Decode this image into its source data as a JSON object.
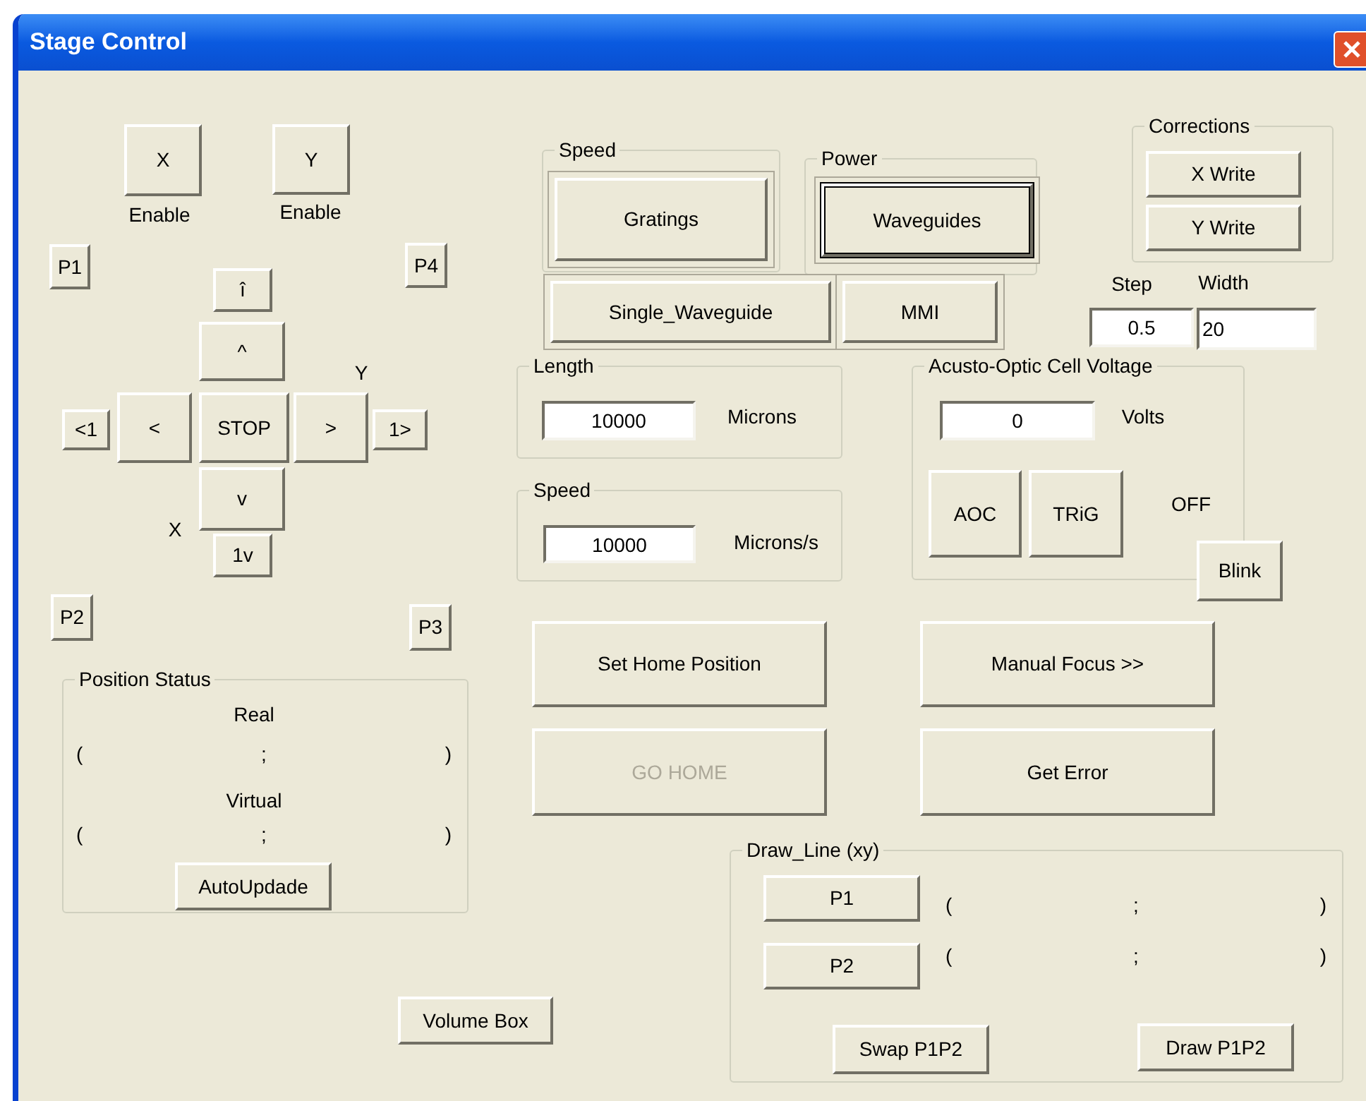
{
  "window": {
    "title": "Stage Control"
  },
  "controls": [
    {
      "kind": "button",
      "label": "X",
      "disabled": false
    },
    {
      "kind": "label",
      "text": "Enable"
    },
    {
      "kind": "button",
      "label": "Y",
      "disabled": false
    },
    {
      "kind": "label",
      "text": "Enable"
    },
    {
      "kind": "button",
      "label": "P1",
      "disabled": false
    },
    {
      "kind": "button",
      "label": "P4",
      "disabled": false
    },
    {
      "kind": "button",
      "label": "î",
      "disabled": false
    },
    {
      "kind": "button",
      "label": "^",
      "disabled": false
    },
    {
      "kind": "label",
      "text": "Y"
    },
    {
      "kind": "button",
      "label": "<1",
      "disabled": false
    },
    {
      "kind": "button",
      "label": "<",
      "disabled": false
    },
    {
      "kind": "button",
      "label": "STOP",
      "disabled": false
    },
    {
      "kind": "button",
      "label": ">",
      "disabled": false
    },
    {
      "kind": "button",
      "label": "1>",
      "disabled": false
    },
    {
      "kind": "button",
      "label": "v",
      "disabled": false
    },
    {
      "kind": "label",
      "text": "X"
    },
    {
      "kind": "button",
      "label": "1v",
      "disabled": false
    },
    {
      "kind": "button",
      "label": "P2",
      "disabled": false
    },
    {
      "kind": "button",
      "label": "P3",
      "disabled": false
    },
    {
      "kind": "group",
      "label": "Position Status"
    },
    {
      "kind": "label",
      "text": "Real"
    },
    {
      "kind": "coords",
      "open": "(",
      "sep": ";",
      "close": ")"
    },
    {
      "kind": "label",
      "text": "Virtual"
    },
    {
      "kind": "coords",
      "open": "(",
      "sep": ";",
      "close": ")"
    },
    {
      "kind": "button",
      "label": "AutoUpdade",
      "disabled": false
    },
    {
      "kind": "button",
      "label": "Volume Box",
      "disabled": false
    },
    {
      "kind": "group",
      "label": "Speed"
    },
    {
      "kind": "framed",
      "label": "Gratings",
      "disabled": false,
      "focused": false
    },
    {
      "kind": "group",
      "label": "Power"
    },
    {
      "kind": "framed",
      "label": "Waveguides",
      "disabled": false,
      "focused": true
    },
    {
      "kind": "framed",
      "label": "Single_Waveguide",
      "disabled": false,
      "focused": false
    },
    {
      "kind": "framed",
      "label": "MMI",
      "disabled": false,
      "focused": false
    },
    {
      "kind": "group",
      "label": "Corrections"
    },
    {
      "kind": "button",
      "label": "X Write",
      "disabled": false
    },
    {
      "kind": "button",
      "label": "Y Write",
      "disabled": false
    },
    {
      "kind": "label",
      "text": "Step"
    },
    {
      "kind": "label",
      "text": "Width"
    },
    {
      "kind": "field",
      "value": "0.5"
    },
    {
      "kind": "field",
      "value": "20"
    },
    {
      "kind": "group",
      "label": "Length"
    },
    {
      "kind": "field",
      "value": "10000"
    },
    {
      "kind": "label",
      "text": "Microns"
    },
    {
      "kind": "group",
      "label": "Speed"
    },
    {
      "kind": "field",
      "value": "10000"
    },
    {
      "kind": "label",
      "text": "Microns/s"
    },
    {
      "kind": "group",
      "label": "Acusto-Optic Cell Voltage"
    },
    {
      "kind": "field",
      "value": "0"
    },
    {
      "kind": "label",
      "text": "Volts"
    },
    {
      "kind": "button",
      "label": "AOC",
      "disabled": false
    },
    {
      "kind": "button",
      "label": "TRiG",
      "disabled": false
    },
    {
      "kind": "label",
      "text": "OFF"
    },
    {
      "kind": "button",
      "label": "Blink",
      "disabled": false
    },
    {
      "kind": "button",
      "label": "Set Home Position",
      "disabled": false
    },
    {
      "kind": "button",
      "label": "GO HOME",
      "disabled": true
    },
    {
      "kind": "button",
      "label": "Manual Focus >>",
      "disabled": false
    },
    {
      "kind": "button",
      "label": "Get Error",
      "disabled": false
    },
    {
      "kind": "group",
      "label": "Draw_Line (xy)"
    },
    {
      "kind": "button",
      "label": "P1",
      "disabled": false
    },
    {
      "kind": "coords",
      "open": "(",
      "sep": ";",
      "close": ")"
    },
    {
      "kind": "button",
      "label": "P2",
      "disabled": false
    },
    {
      "kind": "coords",
      "open": "(",
      "sep": ";",
      "close": ")"
    },
    {
      "kind": "button",
      "label": "Swap P1P2",
      "disabled": false
    },
    {
      "kind": "button",
      "label": "Draw P1P2",
      "disabled": false
    }
  ]
}
